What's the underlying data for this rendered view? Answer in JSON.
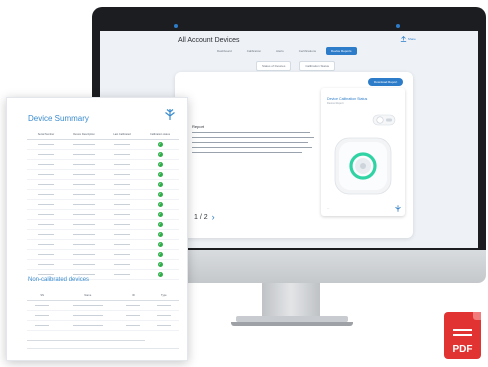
{
  "app": {
    "title": "All Account Devices",
    "share_label": "Share",
    "nav": [
      "Dashboard",
      "Calibration",
      "Alerts",
      "Certifications",
      "Device Reports"
    ],
    "nav_active_index": 4,
    "subtabs": [
      "Status of Devices",
      "Calibration Status"
    ],
    "report_button": "Download Report",
    "card_heading": "Report",
    "pager": "1 / 2",
    "preview": {
      "title": "Device Calibration Status",
      "subtitle": "Device Report"
    }
  },
  "report": {
    "title": "Device Summary",
    "columns": [
      "Serial Number",
      "Device Description",
      "Last Calibrated",
      "Calibration status"
    ],
    "rows": 14,
    "section_title": "Non-calibrated devices",
    "nc_columns": [
      "SN",
      "Name",
      "ID",
      "Type"
    ],
    "nc_rows": 3
  },
  "colors": {
    "brand_blue": "#2d7cc9",
    "status_green": "#2fae4a",
    "pdf_red": "#e23333"
  },
  "badge": {
    "label": "PDF"
  }
}
